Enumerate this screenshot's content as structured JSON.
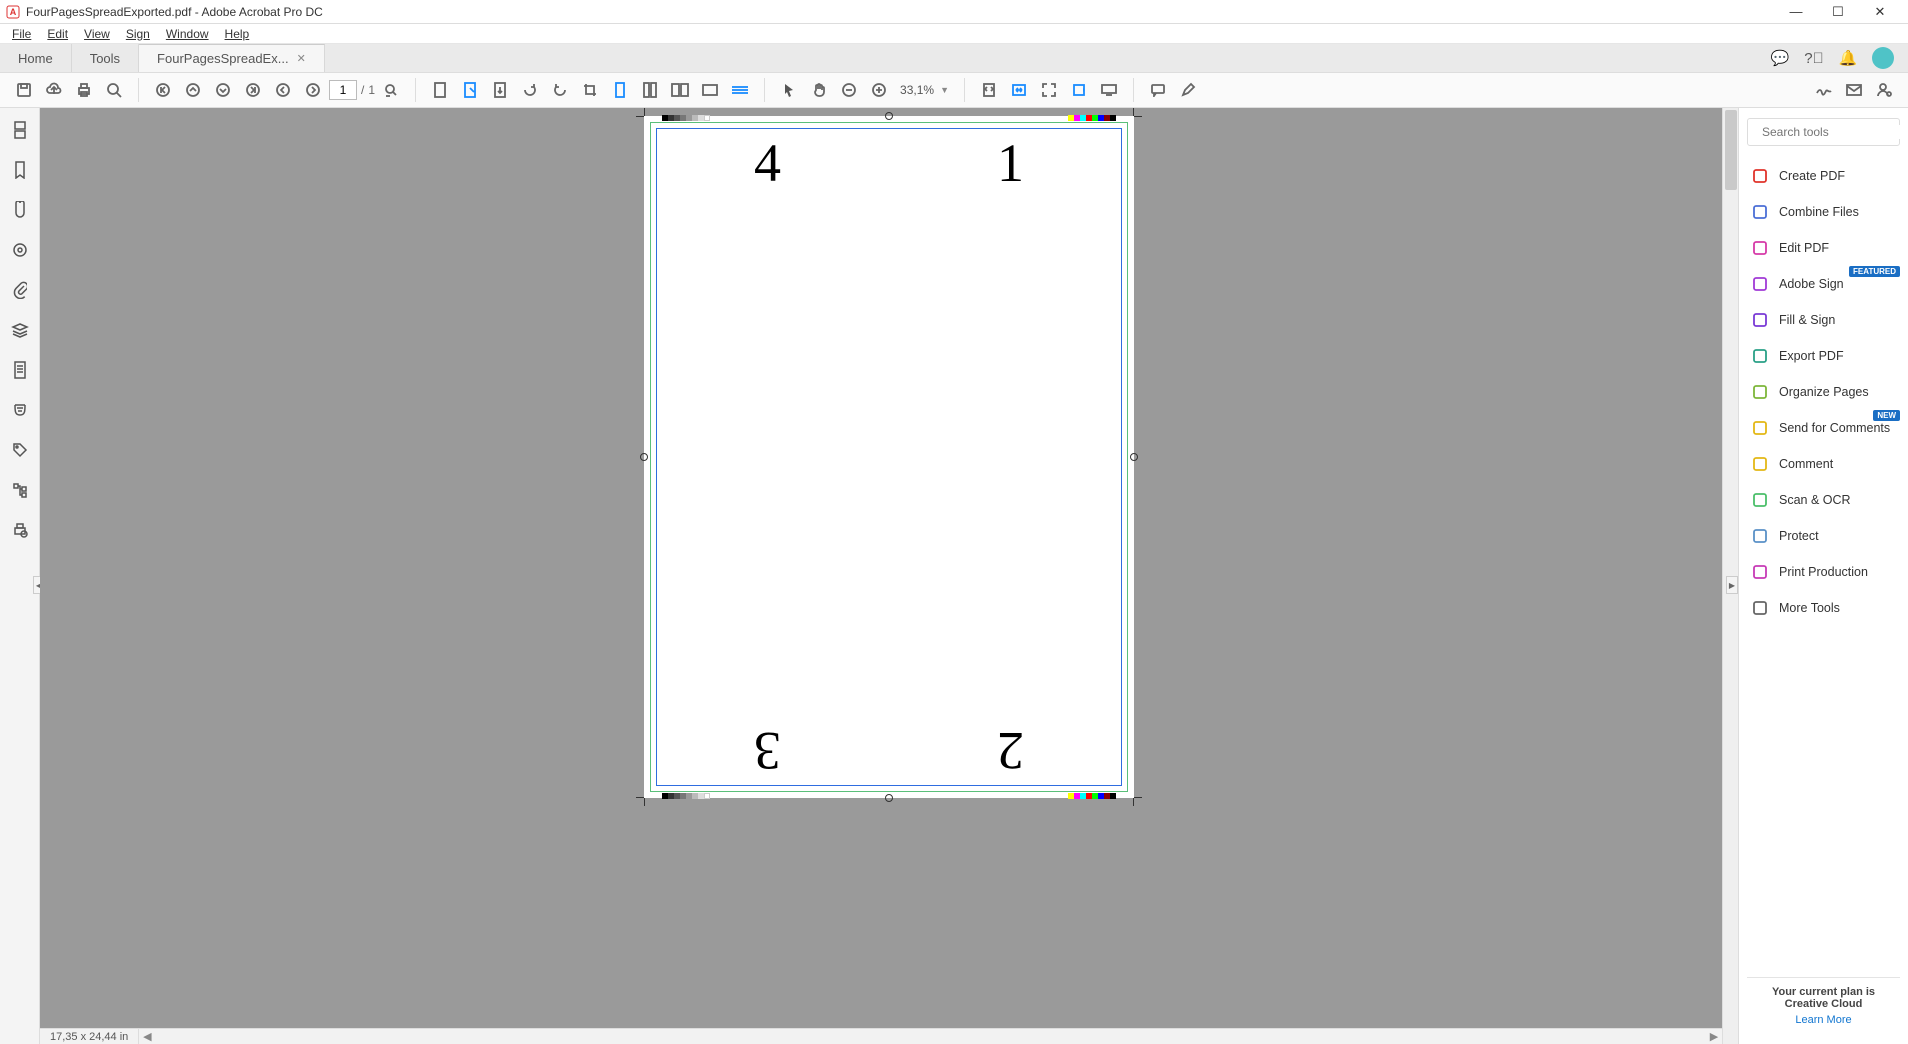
{
  "title": "FourPagesSpreadExported.pdf - Adobe Acrobat Pro DC",
  "menu": {
    "file": "File",
    "edit": "Edit",
    "view": "View",
    "sign": "Sign",
    "window": "Window",
    "help": "Help"
  },
  "tabs": {
    "home": "Home",
    "tools": "Tools",
    "doc": "FourPagesSpreadEx..."
  },
  "toolbar": {
    "page_current": "1",
    "page_sep": "/",
    "page_total": "1",
    "zoom": "33,1%"
  },
  "right": {
    "search_placeholder": "Search tools",
    "items": [
      {
        "label": "Create PDF",
        "color": "#e0342b"
      },
      {
        "label": "Combine Files",
        "color": "#4b6fd6"
      },
      {
        "label": "Edit PDF",
        "color": "#d63aa8"
      },
      {
        "label": "Adobe Sign",
        "color": "#a13ad6",
        "badge": "FEATURED"
      },
      {
        "label": "Fill & Sign",
        "color": "#7a3ad6"
      },
      {
        "label": "Export PDF",
        "color": "#2aa087"
      },
      {
        "label": "Organize Pages",
        "color": "#7db63a"
      },
      {
        "label": "Send for Comments",
        "color": "#e3b816",
        "badge": "NEW"
      },
      {
        "label": "Comment",
        "color": "#e3b816"
      },
      {
        "label": "Scan & OCR",
        "color": "#4bbf6a"
      },
      {
        "label": "Protect",
        "color": "#5a91c7"
      },
      {
        "label": "Print Production",
        "color": "#c73ab6"
      },
      {
        "label": "More Tools",
        "color": "#666"
      }
    ],
    "plan_text": "Your current plan is Creative Cloud",
    "learn_more": "Learn More"
  },
  "status": {
    "dimensions": "17,35 x 24,44 in"
  },
  "doc": {
    "n1": "1",
    "n2": "2",
    "n3": "3",
    "n4": "4"
  }
}
